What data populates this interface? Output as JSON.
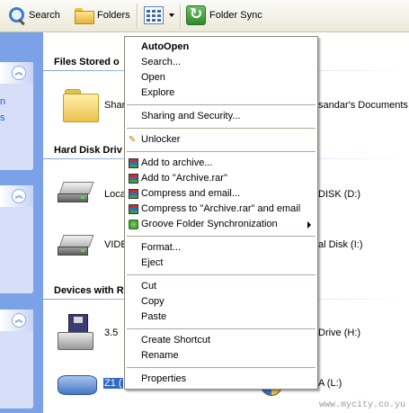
{
  "toolbar": {
    "search_label": "Search",
    "folders_label": "Folders",
    "views_label": "",
    "sync_label": "Folder Sync"
  },
  "leftpane": {
    "fragment1": "n",
    "fragment2": "s"
  },
  "sections": {
    "files_stored": "Files Stored o",
    "hard_disk": "Hard Disk Driv",
    "removable": "Devices with R"
  },
  "items": {
    "shared_left": "Shar",
    "shared_right": "sandar's Documents",
    "local_left": "Loca",
    "local_right": "DISK (D:)",
    "video_left": "VIDE",
    "video_right": "al Disk (I:)",
    "floppy_left": "3.5",
    "floppy_right": "Drive (H:)",
    "selected_left": "Z1 (",
    "selected_right": "A (L:)"
  },
  "context_menu": {
    "items": [
      {
        "label": "AutoOpen",
        "bold": true
      },
      {
        "label": "Search..."
      },
      {
        "label": "Open"
      },
      {
        "label": "Explore"
      },
      {
        "label": "Sharing and Security..."
      },
      {
        "label": "Unlocker",
        "icon": "unlocker-icon"
      },
      {
        "label": "Add to archive...",
        "icon": "winrar-icon"
      },
      {
        "label": "Add to \"Archive.rar\"",
        "icon": "winrar-icon"
      },
      {
        "label": "Compress and email...",
        "icon": "winrar-icon"
      },
      {
        "label": "Compress to \"Archive.rar\" and email",
        "icon": "winrar-icon"
      },
      {
        "label": "Groove Folder Synchronization",
        "icon": "groove-icon",
        "submenu": true
      },
      {
        "label": "Format..."
      },
      {
        "label": "Eject"
      },
      {
        "label": "Cut"
      },
      {
        "label": "Copy"
      },
      {
        "label": "Paste"
      },
      {
        "label": "Create Shortcut"
      },
      {
        "label": "Rename"
      },
      {
        "label": "Properties"
      }
    ]
  },
  "watermark": "www.mycity.co.yu",
  "colors": {
    "taskpane": "#7ba2e7",
    "selection": "#316ac5",
    "menu_border": "#8a867a"
  }
}
